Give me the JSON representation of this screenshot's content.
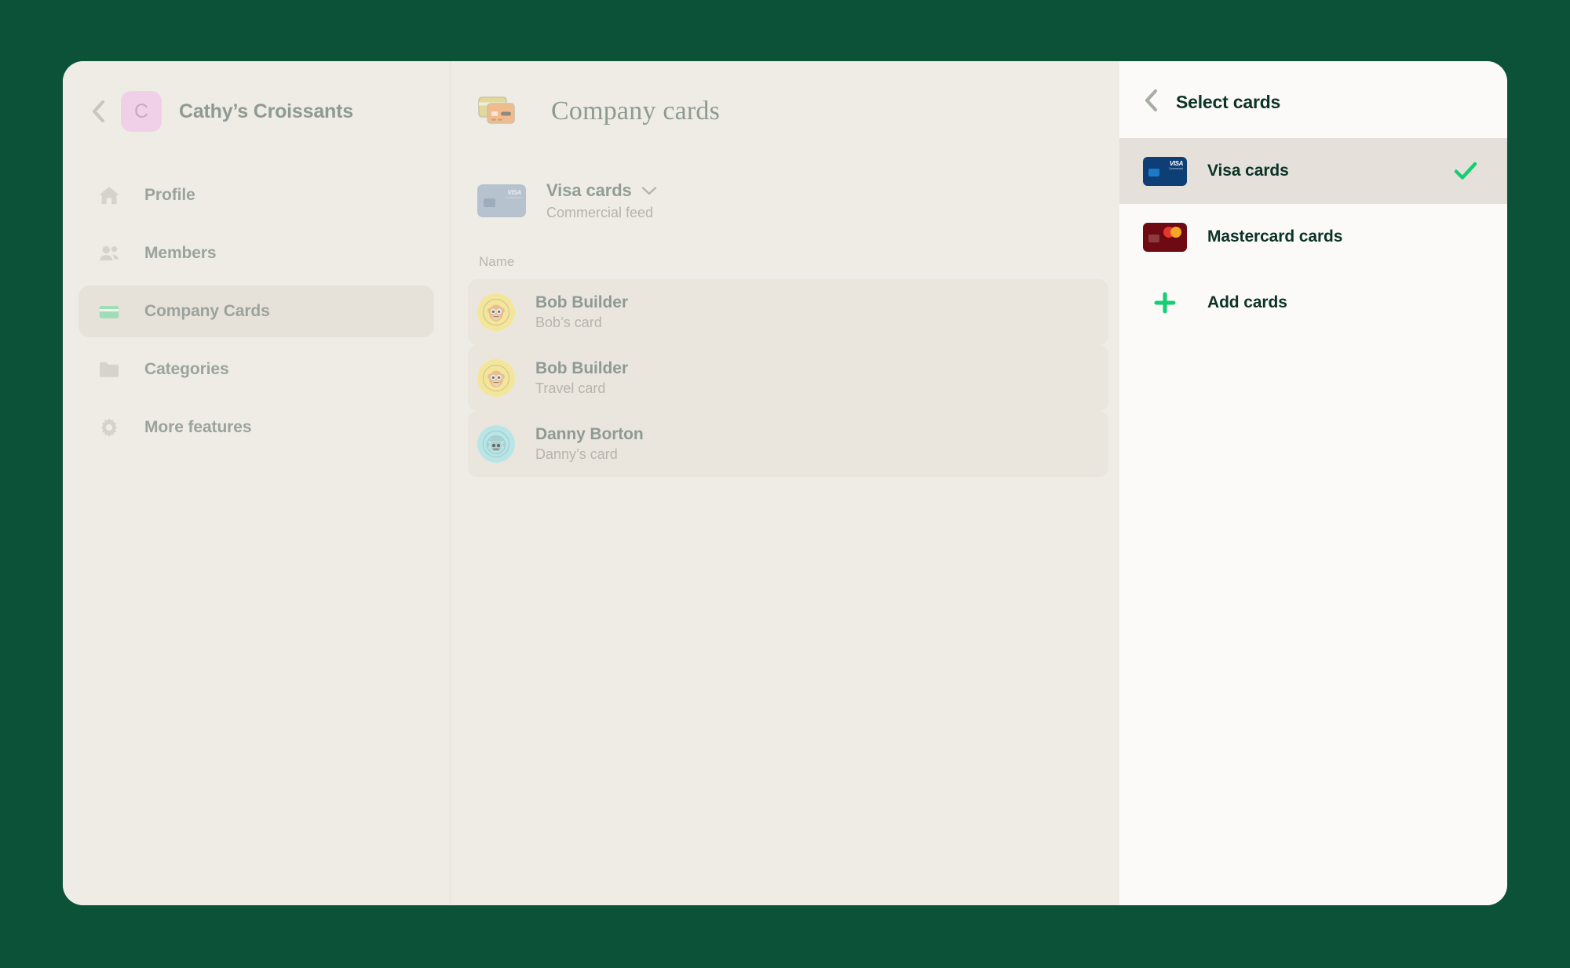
{
  "theme": {
    "page_background": "#0c5239",
    "panel_background": "#efece6",
    "right_panel_background": "#fbfaf8",
    "selected_row_background": "#e5e1da",
    "accent_green": "#11cf72",
    "dark_green_text": "#0c3328",
    "muted_text": "#8f9a93"
  },
  "sidebar": {
    "back_label": "Back",
    "org": {
      "avatar_letter": "C",
      "name": "Cathy’s Croissants"
    },
    "items": [
      {
        "label": "Profile",
        "icon": "home-icon",
        "active": false
      },
      {
        "label": "Members",
        "icon": "people-icon",
        "active": false
      },
      {
        "label": "Company Cards",
        "icon": "credit-card-icon",
        "active": true
      },
      {
        "label": "Categories",
        "icon": "folder-icon",
        "active": false
      },
      {
        "label": "More features",
        "icon": "gear-icon",
        "active": false
      }
    ]
  },
  "main": {
    "title": "Company cards",
    "title_icon": "stacked-cards-icon",
    "feed": {
      "name": "Visa cards",
      "subtitle": "Commercial feed",
      "card_brand": "VISA",
      "card_brand_sub": "Commercial",
      "caret": "chevron-down-icon"
    },
    "column_header": "Name",
    "rows": [
      {
        "name": "Bob Builder",
        "card": "Bob’s card",
        "avatar_color": "#f3e59a",
        "avatar_icon": "monkey-avatar"
      },
      {
        "name": "Bob Builder",
        "card": "Travel card",
        "avatar_color": "#f3e59a",
        "avatar_icon": "monkey-avatar"
      },
      {
        "name": "Danny Borton",
        "card": "Danny’s card",
        "avatar_color": "#b9e5e6",
        "avatar_icon": "robot-avatar"
      }
    ]
  },
  "right_panel": {
    "title": "Select cards",
    "back_icon": "chevron-left-icon",
    "options": [
      {
        "label": "Visa cards",
        "brand": "visa",
        "selected": true,
        "check_icon": "check-icon"
      },
      {
        "label": "Mastercard cards",
        "brand": "mastercard",
        "selected": false,
        "check_icon": ""
      }
    ],
    "add": {
      "label": "Add cards",
      "icon": "plus-icon"
    }
  }
}
